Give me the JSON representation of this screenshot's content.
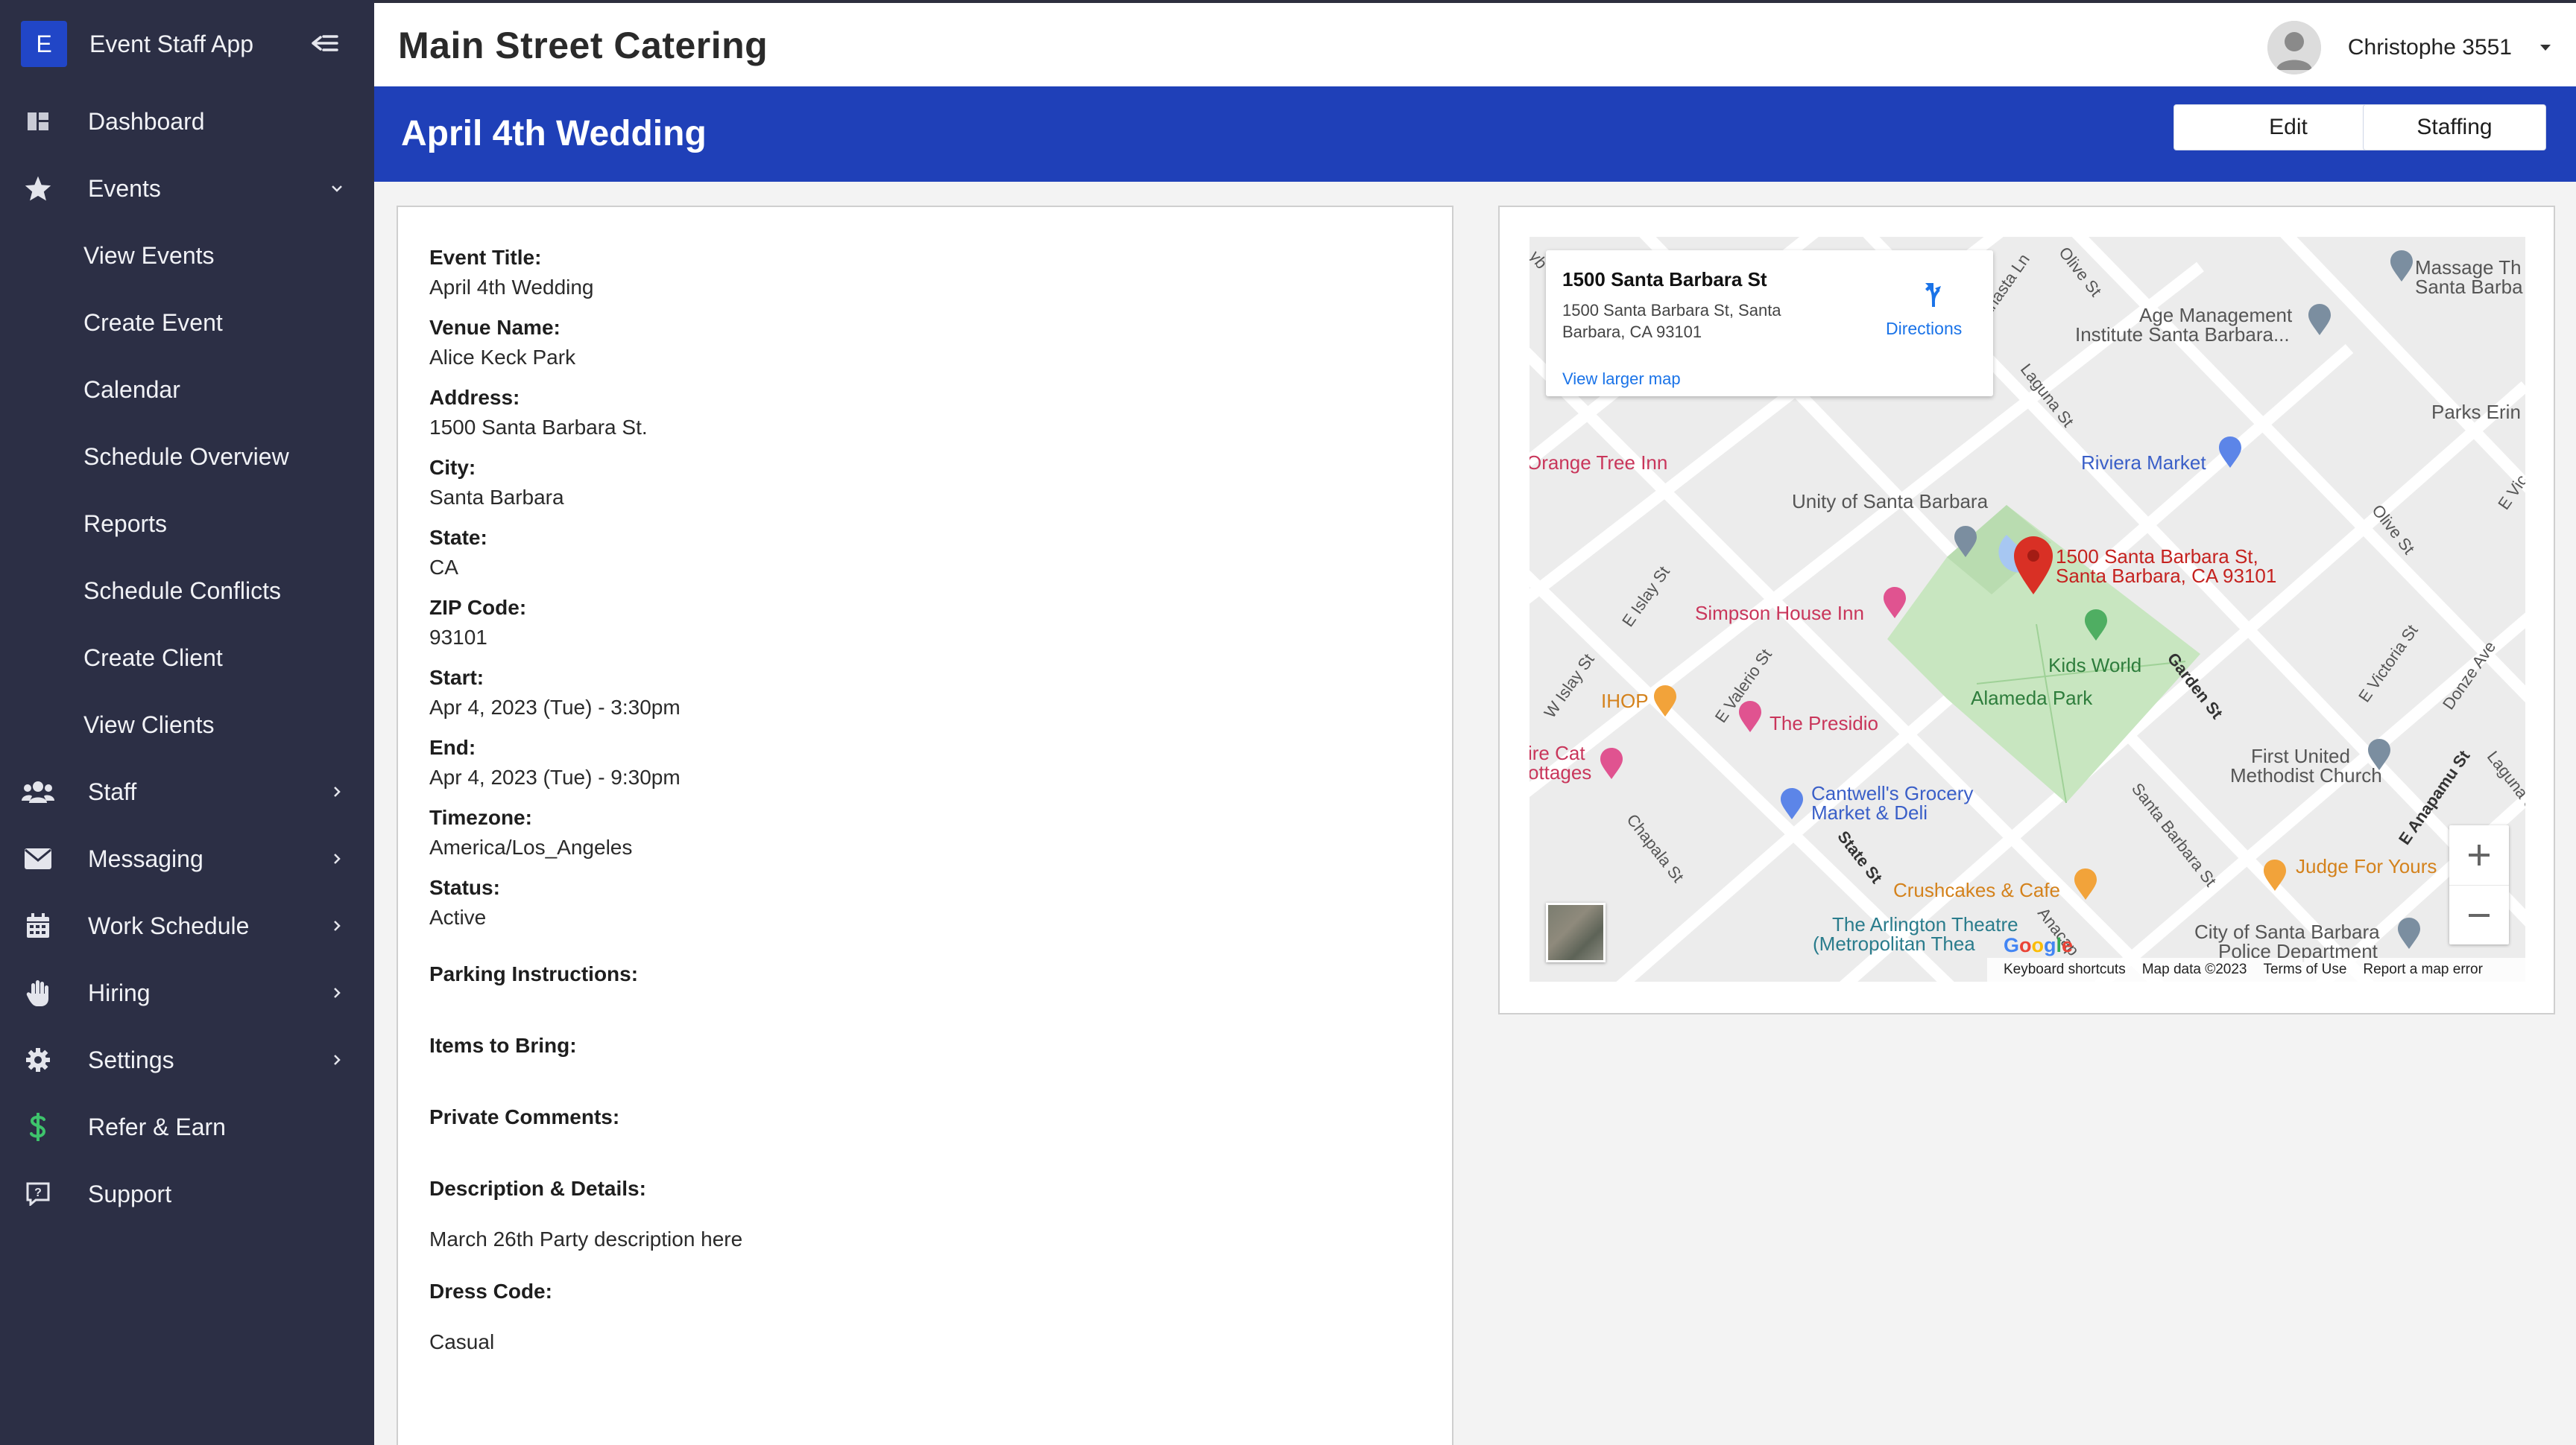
{
  "app": {
    "brand_letter": "E",
    "brand_name": "Event Staff App",
    "company": "Main Street Catering",
    "user_name": "Christophe 3551"
  },
  "sidebar": {
    "items": [
      {
        "label": "Dashboard",
        "icon": "dashboard-icon"
      },
      {
        "label": "Events",
        "icon": "star-icon",
        "expanded": true
      },
      {
        "label": "View Events",
        "sub": true
      },
      {
        "label": "Create Event",
        "sub": true
      },
      {
        "label": "Calendar",
        "sub": true
      },
      {
        "label": "Schedule Overview",
        "sub": true
      },
      {
        "label": "Reports",
        "sub": true
      },
      {
        "label": "Schedule Conflicts",
        "sub": true
      },
      {
        "label": "Create Client",
        "sub": true
      },
      {
        "label": "View Clients",
        "sub": true
      },
      {
        "label": "Staff",
        "icon": "users-icon"
      },
      {
        "label": "Messaging",
        "icon": "envelope-icon"
      },
      {
        "label": "Work Schedule",
        "icon": "calendar-icon"
      },
      {
        "label": "Hiring",
        "icon": "hand-icon"
      },
      {
        "label": "Settings",
        "icon": "gear-icon"
      },
      {
        "label": "Refer & Earn",
        "icon": "dollar-icon"
      },
      {
        "label": "Support",
        "icon": "support-icon"
      }
    ]
  },
  "event": {
    "title": "April 4th Wedding",
    "edit_label": "Edit",
    "staffing_label": "Staffing",
    "fields": [
      {
        "label": "Event Title:",
        "value": "April 4th Wedding"
      },
      {
        "label": "Venue Name:",
        "value": "Alice Keck Park"
      },
      {
        "label": "Address:",
        "value": "1500 Santa Barbara St."
      },
      {
        "label": "City:",
        "value": "Santa Barbara"
      },
      {
        "label": "State:",
        "value": "CA"
      },
      {
        "label": "ZIP Code:",
        "value": "93101"
      },
      {
        "label": "Start:",
        "value": "Apr 4, 2023 (Tue) - 3:30pm"
      },
      {
        "label": "End:",
        "value": "Apr 4, 2023 (Tue) - 9:30pm"
      },
      {
        "label": "Timezone:",
        "value": "America/Los_Angeles"
      },
      {
        "label": "Status:",
        "value": "Active"
      }
    ],
    "parking_label": "Parking Instructions:",
    "items_label": "Items to Bring:",
    "comments_label": "Private Comments:",
    "description_label": "Description & Details:",
    "description_value": "March 26th Party description here",
    "dress_label": "Dress Code:",
    "dress_value": "Casual"
  },
  "map": {
    "info_title": "1500 Santa Barbara St",
    "info_address": "1500 Santa Barbara St, Santa Barbara, CA 93101",
    "directions": "Directions",
    "view_larger": "View larger map",
    "pin_label_1": "1500 Santa Barbara St,",
    "pin_label_2": "Santa Barbara, CA 93101",
    "places": {
      "massage": "Massage Th",
      "massage2": "Santa Barba",
      "age1": "Age Management",
      "age2": "Institute Santa Barbara...",
      "parks": "Parks Erin",
      "orange": "Orange Tree Inn",
      "riviera": "Riviera Market",
      "unity": "Unity of Santa Barbara",
      "simpson": "Simpson House Inn",
      "kids": "Kids World",
      "alameda": "Alameda Park",
      "ihop": "IHOP",
      "presidio": "The Presidio",
      "firecat1": "ire Cat",
      "firecat2": "ottages",
      "cantwell1": "Cantwell's Grocery",
      "cantwell2": "Market & Deli",
      "methodist1": "First United",
      "methodist2": "Methodist Church",
      "judge": "Judge For Yours",
      "crushcakes": "Crushcakes & Cafe",
      "arlington1": "The Arlington Theatre",
      "arlington2": "(Metropolitan Thea",
      "police1": "City of Santa Barbara",
      "police2": "Police Department"
    },
    "streets": {
      "olive": "Olive St",
      "olive2": "Olive St",
      "laguna": "Laguna St",
      "laguna2": "Laguna St",
      "santa_ln": "anasta Ln",
      "islay": "E Islay St",
      "w_islay": "W Islay St",
      "valerio": "E Valerio St",
      "garden": "Garden St",
      "victoria": "E Victoria St",
      "donze": "Donze Ave",
      "anapamu": "E Anapamu St",
      "chapala": "Chapala St",
      "state": "State St",
      "sb_st": "Santa Barbara St",
      "anacapa": "Anacap",
      "e_vic": "E Vic",
      "yb": "yb"
    },
    "google": "Google",
    "footer": {
      "shortcuts": "Keyboard shortcuts",
      "data": "Map data ©2023",
      "terms": "Terms of Use",
      "report": "Report a map error"
    }
  },
  "colors": {
    "sidebar": "#2c2f45",
    "accent": "#1f40b8",
    "brand_logo": "#2146c7",
    "dollar": "#3ec36c",
    "map_pin": "#d93025",
    "park": "#c8e6c0"
  }
}
